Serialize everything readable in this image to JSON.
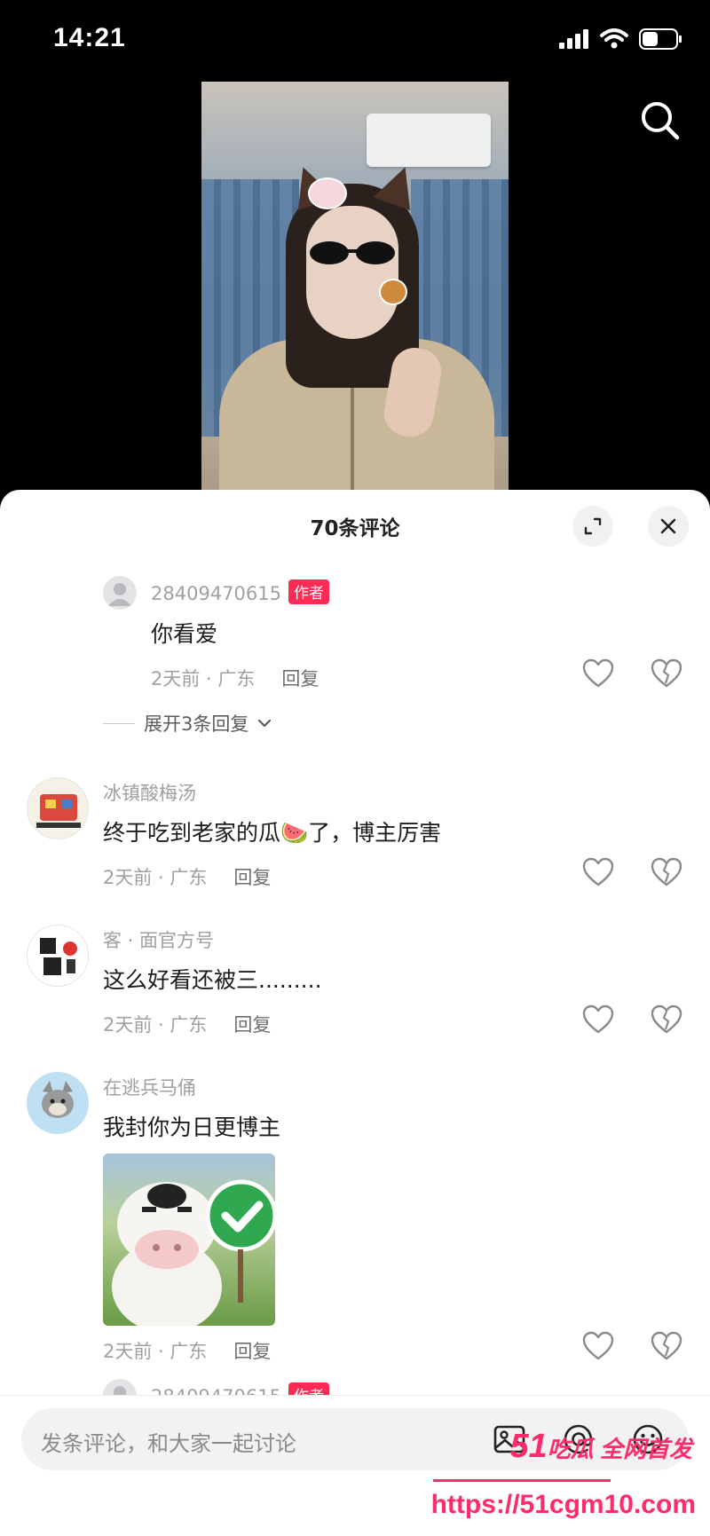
{
  "status_bar": {
    "time": "14:21"
  },
  "sheet": {
    "title": "70条评论"
  },
  "comments": [
    {
      "username": "28409470615",
      "badge": "作者",
      "text": "你看爱",
      "time": "2天前 · 广东",
      "reply": "回复",
      "expand": "展开3条回复"
    },
    {
      "username": "冰镇酸梅汤",
      "text": "终于吃到老家的瓜🍉了，博主厉害",
      "time": "2天前 · 广东",
      "reply": "回复"
    },
    {
      "username": "客 · 面官方号",
      "text": "这么好看还被三.........",
      "time": "2天前 · 广东",
      "reply": "回复"
    },
    {
      "username": "在逃兵马俑",
      "text": "我封你为日更博主",
      "time": "2天前 · 广东",
      "reply": "回复"
    },
    {
      "username": "28409470615",
      "badge": "作者"
    }
  ],
  "input": {
    "placeholder": "发条评论，和大家一起讨论"
  },
  "watermark": {
    "brand_num": "51",
    "brand_text": "吃瓜 全网首发",
    "url": "https://51cgm10.com"
  },
  "colors": {
    "accent": "#fe2c55",
    "watermark": "#ff2b6a"
  },
  "icons": [
    "search-icon",
    "expand-icon",
    "close-icon",
    "heart-icon",
    "broken-heart-icon",
    "image-icon",
    "at-icon",
    "emoji-icon"
  ]
}
